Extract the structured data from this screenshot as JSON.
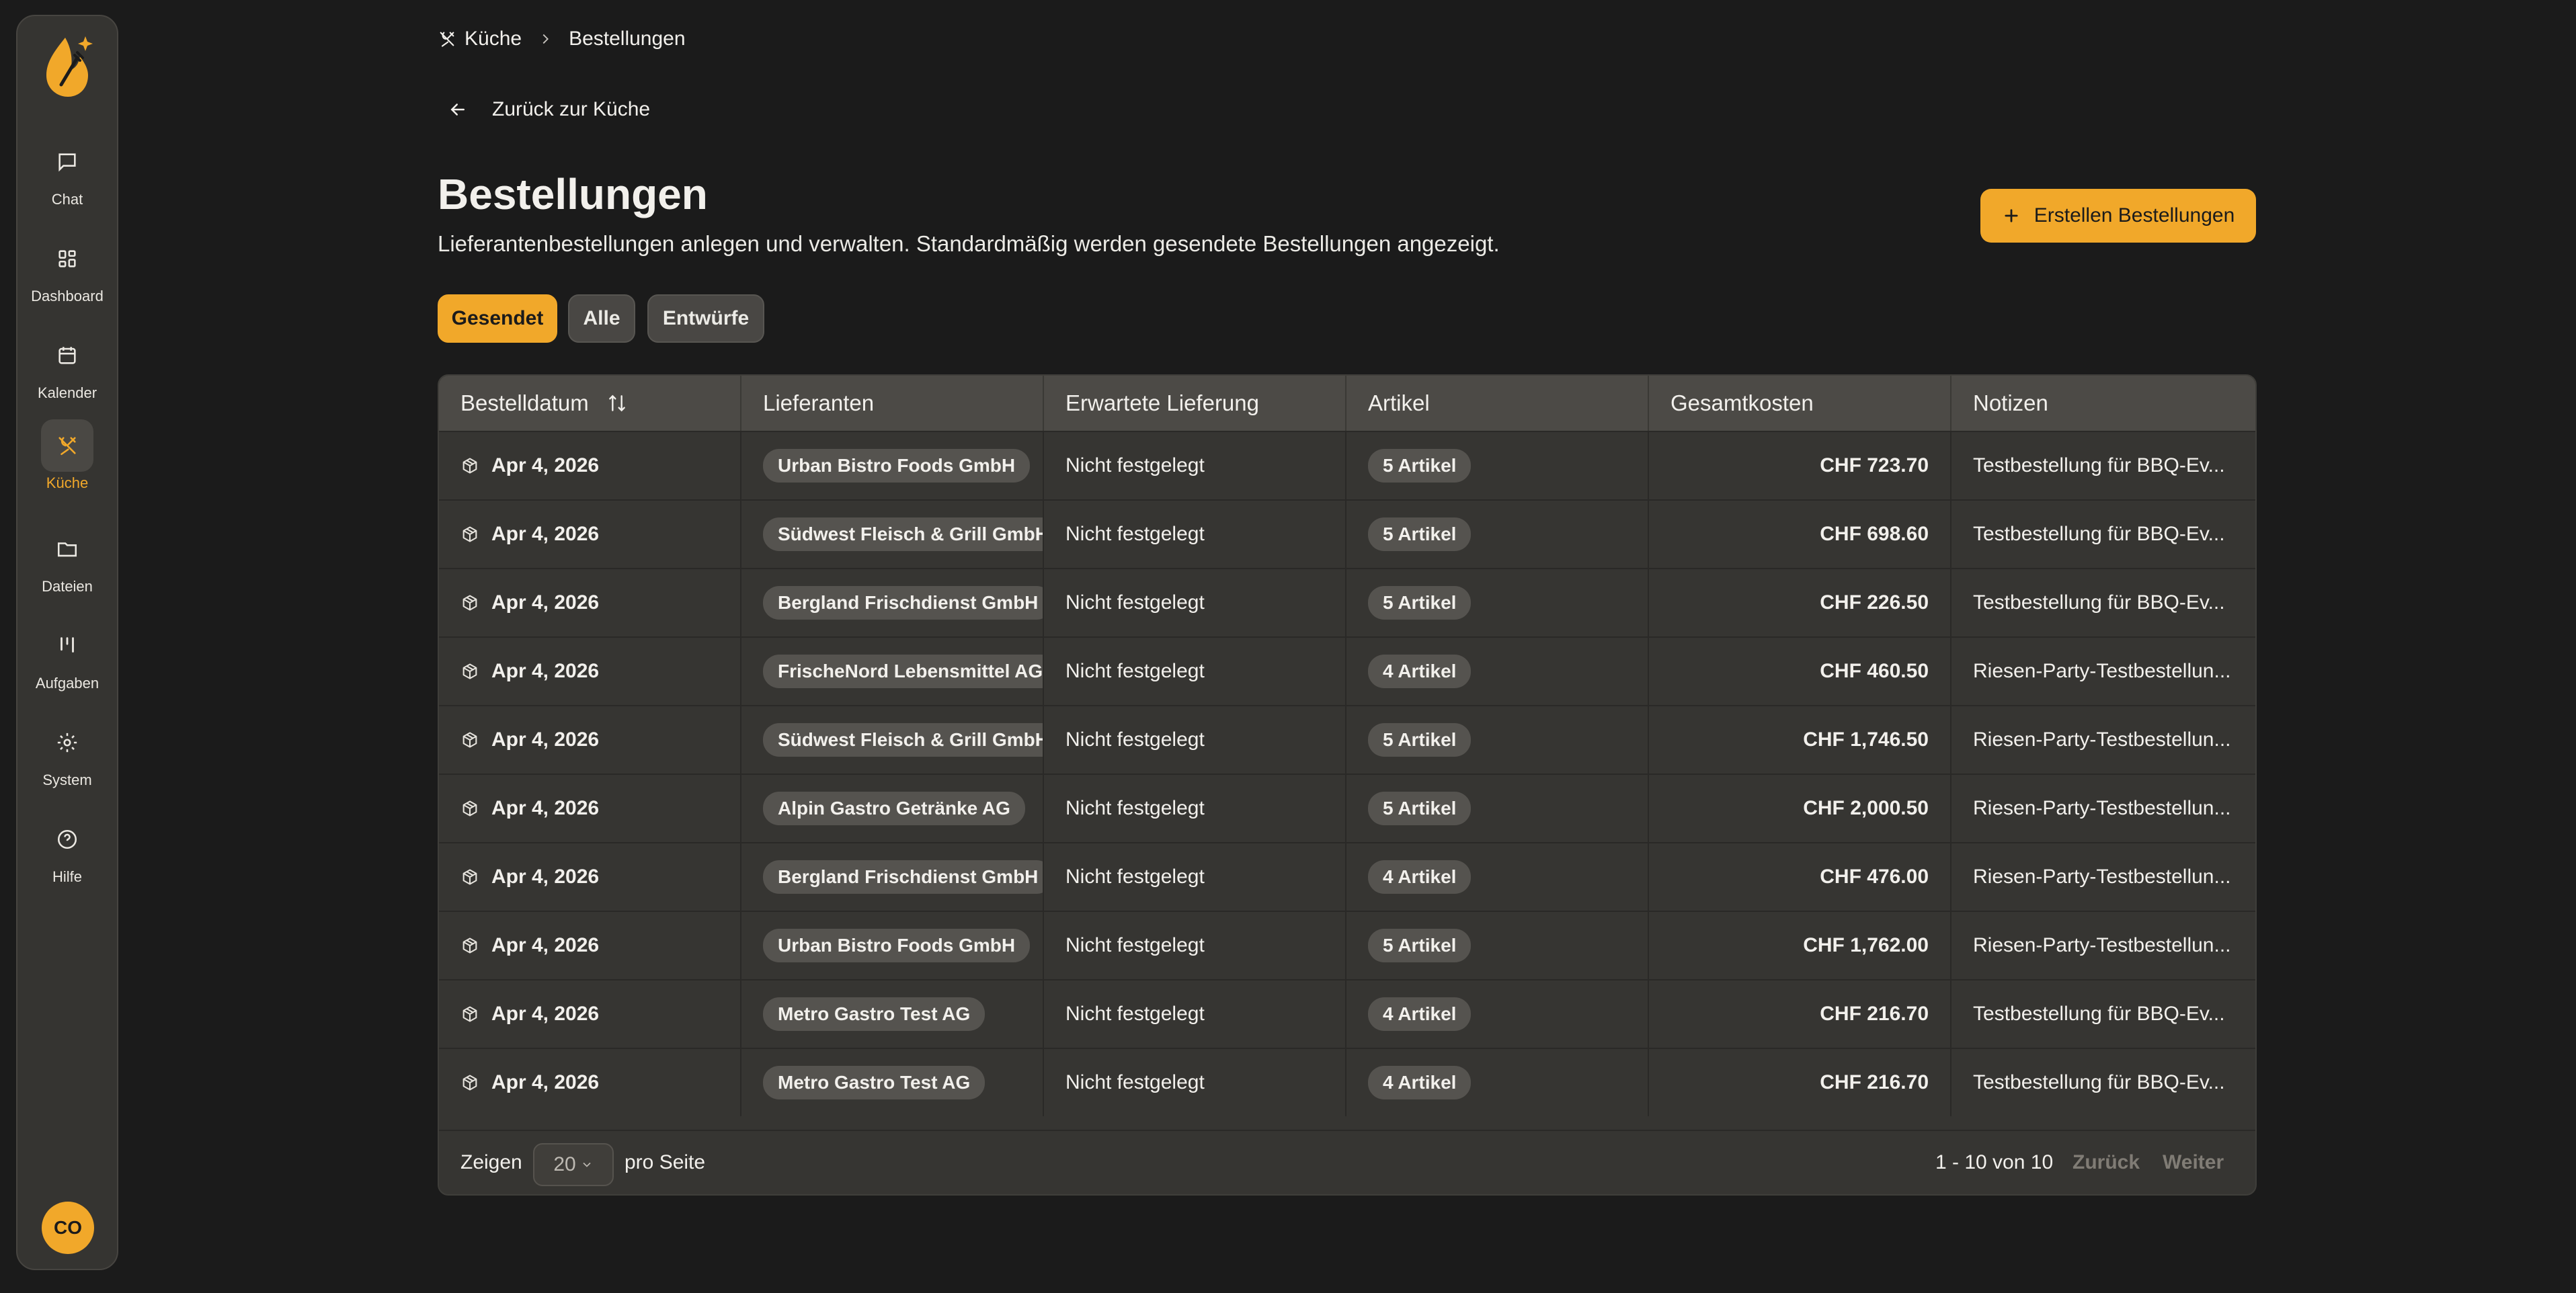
{
  "sidebar": {
    "items": [
      {
        "label": "Chat",
        "icon": "chat-icon"
      },
      {
        "label": "Dashboard",
        "icon": "dashboard-icon"
      },
      {
        "label": "Kalender",
        "icon": "calendar-icon"
      },
      {
        "label": "Küche",
        "icon": "utensils-icon",
        "active": true
      },
      {
        "label": "Dateien",
        "icon": "folder-icon"
      },
      {
        "label": "Aufgaben",
        "icon": "kanban-icon"
      },
      {
        "label": "System",
        "icon": "gear-icon"
      },
      {
        "label": "Hilfe",
        "icon": "help-icon"
      }
    ],
    "avatar_initials": "CO"
  },
  "breadcrumb": {
    "parent": "Küche",
    "current": "Bestellungen"
  },
  "back_link": "Zurück zur Küche",
  "page": {
    "title": "Bestellungen",
    "subtitle": "Lieferantenbestellungen anlegen und verwalten. Standardmäßig werden gesendete Bestellungen angezeigt.",
    "create_button": "Erstellen Bestellungen"
  },
  "filters": [
    {
      "label": "Gesendet",
      "active": true
    },
    {
      "label": "Alle",
      "active": false
    },
    {
      "label": "Entwürfe",
      "active": false
    }
  ],
  "table": {
    "columns": [
      "Bestelldatum",
      "Lieferanten",
      "Erwartete Lieferung",
      "Artikel",
      "Gesamtkosten",
      "Notizen"
    ],
    "rows": [
      {
        "date": "Apr 4, 2026",
        "supplier": "Urban Bistro Foods GmbH",
        "delivery": "Nicht festgelegt",
        "items": "5 Artikel",
        "total": "CHF 723.70",
        "notes": "Testbestellung für BBQ-Ev..."
      },
      {
        "date": "Apr 4, 2026",
        "supplier": "Südwest Fleisch & Grill GmbH",
        "delivery": "Nicht festgelegt",
        "items": "5 Artikel",
        "total": "CHF 698.60",
        "notes": "Testbestellung für BBQ-Ev..."
      },
      {
        "date": "Apr 4, 2026",
        "supplier": "Bergland Frischdienst GmbH",
        "delivery": "Nicht festgelegt",
        "items": "5 Artikel",
        "total": "CHF 226.50",
        "notes": "Testbestellung für BBQ-Ev..."
      },
      {
        "date": "Apr 4, 2026",
        "supplier": "FrischeNord Lebensmittel AG",
        "delivery": "Nicht festgelegt",
        "items": "4 Artikel",
        "total": "CHF 460.50",
        "notes": "Riesen-Party-Testbestellun..."
      },
      {
        "date": "Apr 4, 2026",
        "supplier": "Südwest Fleisch & Grill GmbH",
        "delivery": "Nicht festgelegt",
        "items": "5 Artikel",
        "total": "CHF 1,746.50",
        "notes": "Riesen-Party-Testbestellun..."
      },
      {
        "date": "Apr 4, 2026",
        "supplier": "Alpin Gastro Getränke AG",
        "delivery": "Nicht festgelegt",
        "items": "5 Artikel",
        "total": "CHF 2,000.50",
        "notes": "Riesen-Party-Testbestellun..."
      },
      {
        "date": "Apr 4, 2026",
        "supplier": "Bergland Frischdienst GmbH",
        "delivery": "Nicht festgelegt",
        "items": "4 Artikel",
        "total": "CHF 476.00",
        "notes": "Riesen-Party-Testbestellun..."
      },
      {
        "date": "Apr 4, 2026",
        "supplier": "Urban Bistro Foods GmbH",
        "delivery": "Nicht festgelegt",
        "items": "5 Artikel",
        "total": "CHF 1,762.00",
        "notes": "Riesen-Party-Testbestellun..."
      },
      {
        "date": "Apr 4, 2026",
        "supplier": "Metro Gastro Test AG",
        "delivery": "Nicht festgelegt",
        "items": "4 Artikel",
        "total": "CHF 216.70",
        "notes": "Testbestellung für BBQ-Ev..."
      },
      {
        "date": "Apr 4, 2026",
        "supplier": "Metro Gastro Test AG",
        "delivery": "Nicht festgelegt",
        "items": "4 Artikel",
        "total": "CHF 216.70",
        "notes": "Testbestellung für BBQ-Ev..."
      }
    ]
  },
  "pagination": {
    "show_label": "Zeigen",
    "page_size": "20",
    "per_page_label": "pro Seite",
    "range": "1 - 10 von 10",
    "prev": "Zurück",
    "next": "Weiter"
  },
  "colors": {
    "accent": "#f1a82a",
    "background": "#1b1b1b",
    "surface": "#363532"
  }
}
